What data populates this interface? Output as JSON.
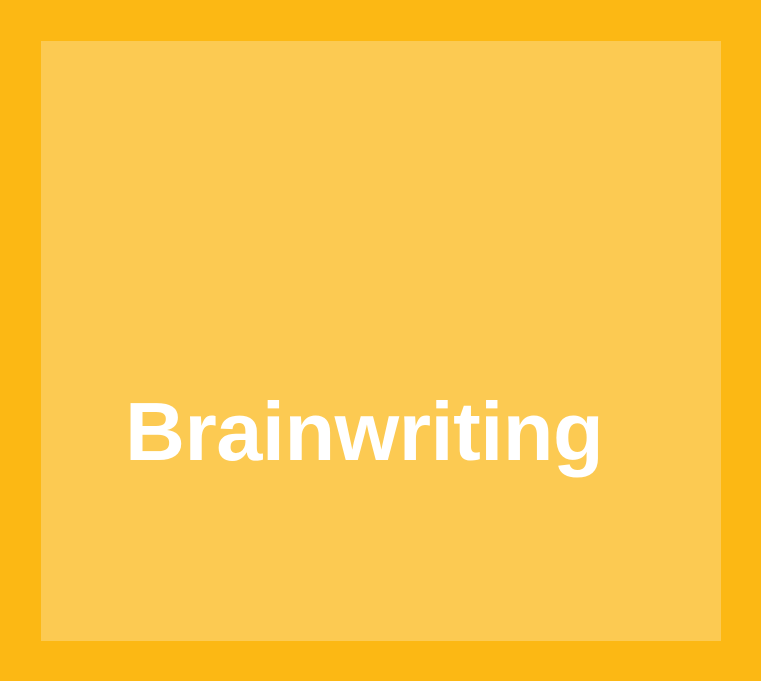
{
  "title": "Brainwriting",
  "colors": {
    "frame": "#FCB814",
    "panel": "#FCCA52",
    "text": "#FFFFFF"
  }
}
